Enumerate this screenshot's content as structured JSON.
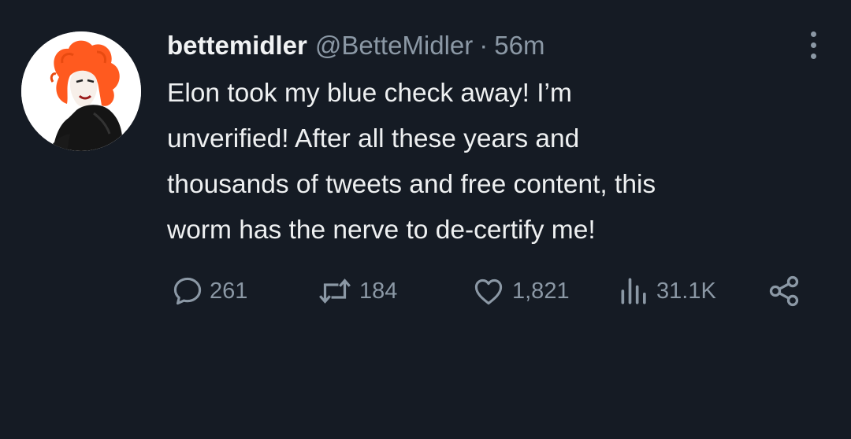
{
  "tweet": {
    "display_name": "bettemidler",
    "handle": "@BetteMidler",
    "separator": "·",
    "time": "56m",
    "text_lines": [
      "Elon took my blue check away! I’m",
      "unverified!  After all these years and",
      "thousands of tweets and free content, this",
      "worm has the nerve to de-certify me!"
    ],
    "avatar_icon": "avatar-illustration",
    "more_icon": "more-options-icon"
  },
  "actions": {
    "reply": {
      "icon": "reply-icon",
      "count": "261"
    },
    "retweet": {
      "icon": "retweet-icon",
      "count": "184"
    },
    "like": {
      "icon": "heart-icon",
      "count": "1,821"
    },
    "views": {
      "icon": "views-icon",
      "count": "31.1K"
    },
    "share": {
      "icon": "share-icon"
    }
  },
  "colors": {
    "background": "#151b24",
    "primary_text": "#e7e9ea",
    "secondary_text": "#8b98a5",
    "avatar_hair": "#ff5a1f"
  }
}
